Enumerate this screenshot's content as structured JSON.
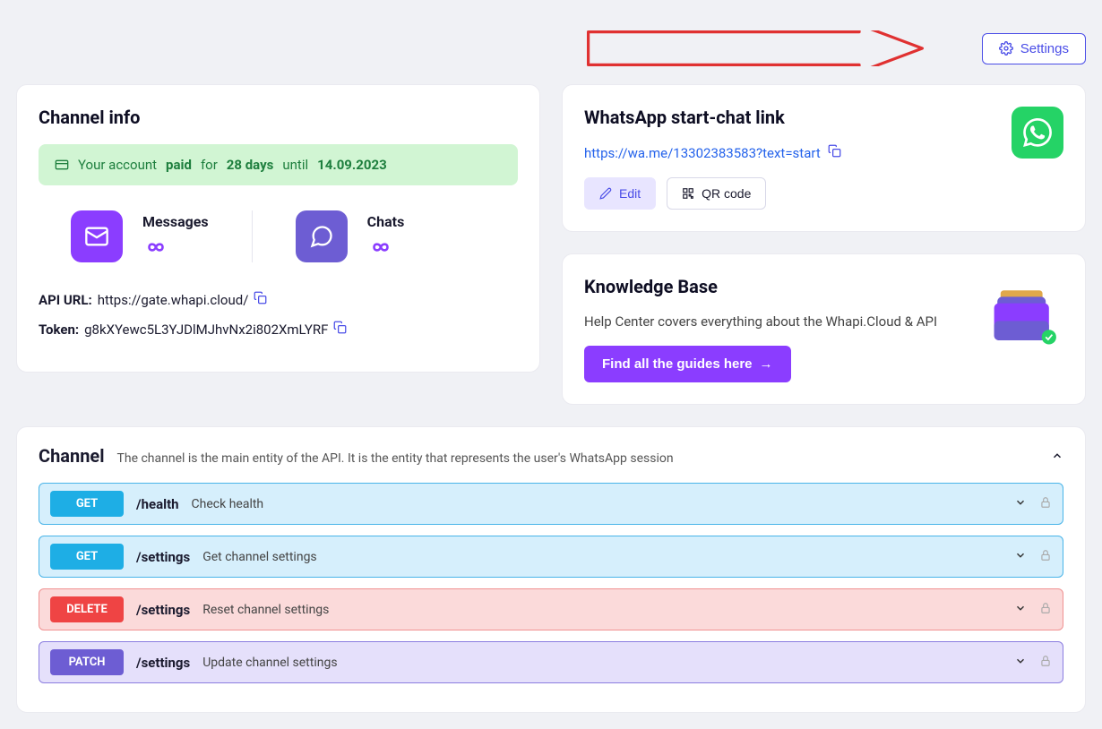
{
  "settings_button": "Settings",
  "channel_info": {
    "title": "Channel info",
    "banner": {
      "prefix": "Your account",
      "paid": "paid",
      "for": "for",
      "days": "28 days",
      "until_word": "until",
      "date": "14.09.2023"
    },
    "stats": {
      "messages": {
        "label": "Messages",
        "value": "∞"
      },
      "chats": {
        "label": "Chats",
        "value": "∞"
      }
    },
    "api_url_label": "API URL:",
    "api_url": "https://gate.whapi.cloud/",
    "token_label": "Token:",
    "token": "g8kXYewc5L3YJDlMJhvNx2i802XmLYRF"
  },
  "whatsapp_link": {
    "title": "WhatsApp start-chat link",
    "url": "https://wa.me/13302383583?text=start",
    "edit_label": "Edit",
    "qr_label": "QR code"
  },
  "knowledge_base": {
    "title": "Knowledge Base",
    "desc": "Help Center covers everything about the Whapi.Cloud & API",
    "button": "Find all the guides here"
  },
  "api": {
    "title": "Channel",
    "desc": "The channel is the main entity of the API. It is the entity that represents the user's WhatsApp session",
    "endpoints": [
      {
        "method": "GET",
        "path": "/health",
        "desc": "Check health"
      },
      {
        "method": "GET",
        "path": "/settings",
        "desc": "Get channel settings"
      },
      {
        "method": "DELETE",
        "path": "/settings",
        "desc": "Reset channel settings"
      },
      {
        "method": "PATCH",
        "path": "/settings",
        "desc": "Update channel settings"
      }
    ]
  }
}
